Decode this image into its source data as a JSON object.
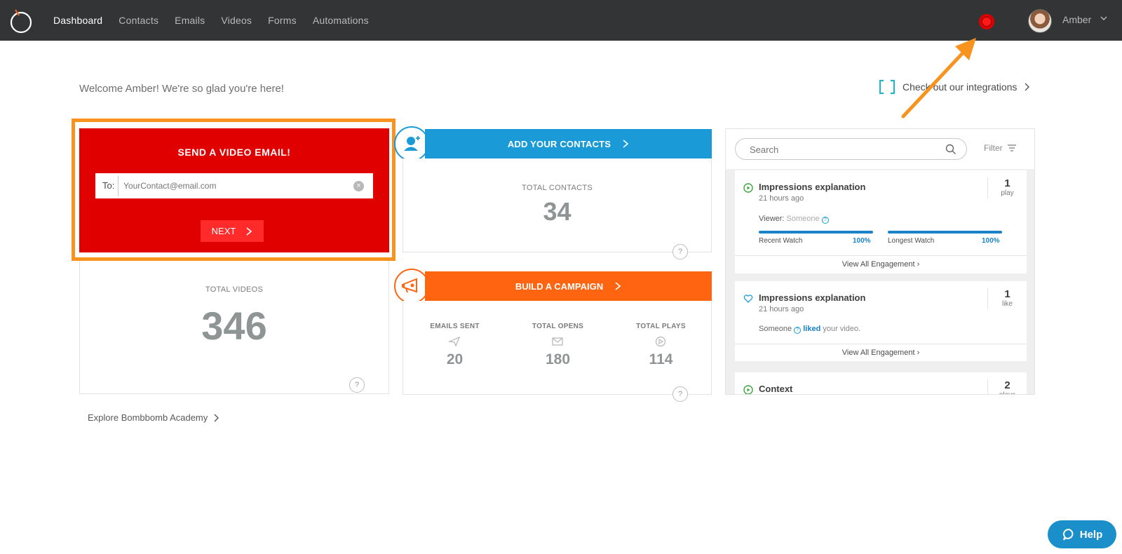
{
  "nav": {
    "items": [
      "Dashboard",
      "Contacts",
      "Emails",
      "Videos",
      "Forms",
      "Automations"
    ],
    "active": "Dashboard"
  },
  "user": {
    "name": "Amber"
  },
  "welcome": "Welcome Amber! We're so glad you're here!",
  "integrations_label": "Check out our integrations",
  "send_video": {
    "title": "SEND A VIDEO EMAIL!",
    "to_label": "To:",
    "placeholder": "YourContact@email.com",
    "next_label": "NEXT"
  },
  "videos": {
    "label": "TOTAL VIDEOS",
    "value": "346"
  },
  "contacts": {
    "banner": "ADD YOUR CONTACTS",
    "label": "TOTAL CONTACTS",
    "value": "34"
  },
  "campaign": {
    "banner": "BUILD A CAMPAIGN",
    "stats": [
      {
        "label": "EMAILS SENT",
        "value": "20",
        "icon": "paper-plane-icon"
      },
      {
        "label": "TOTAL OPENS",
        "value": "180",
        "icon": "envelope-icon"
      },
      {
        "label": "TOTAL PLAYS",
        "value": "114",
        "icon": "play-icon"
      }
    ]
  },
  "help_q": "?",
  "academy": "Explore Bombbomb Academy",
  "activity": {
    "search_placeholder": "Search",
    "filter_label": "Filter",
    "items": [
      {
        "title": "Impressions explanation",
        "time": "21 hours ago",
        "count": "1",
        "unit": "play",
        "viewer_label": "Viewer:",
        "viewer": "Someone",
        "recent_label": "Recent Watch",
        "recent_pct": "100%",
        "recent_value": 1.0,
        "longest_label": "Longest Watch",
        "longest_pct": "100%",
        "longest_value": 1.0,
        "footer": "View All Engagement"
      },
      {
        "title": "Impressions explanation",
        "time": "21 hours ago",
        "count": "1",
        "unit": "like",
        "who": "Someone",
        "action": "liked",
        "rest": "your video.",
        "footer": "View All Engagement"
      },
      {
        "title": "Context",
        "count": "2",
        "unit": "plays"
      }
    ]
  },
  "help_button": "Help",
  "colors": {
    "topbar": "#333435",
    "accent_red": "#e00000",
    "accent_blue": "#1a9bd7",
    "accent_orange": "#ff6410",
    "highlight_orange": "#f7931e"
  }
}
